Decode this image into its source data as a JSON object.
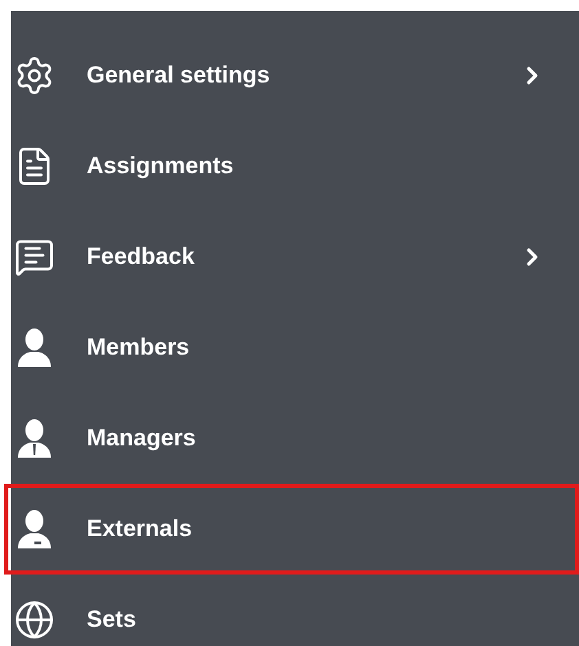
{
  "menu": {
    "items": [
      {
        "kind": "settings",
        "label": "General settings",
        "expandable": true,
        "selected": false
      },
      {
        "kind": "document",
        "label": "Assignments",
        "expandable": false,
        "selected": false
      },
      {
        "kind": "feedback",
        "label": "Feedback",
        "expandable": true,
        "selected": false
      },
      {
        "kind": "member",
        "label": "Members",
        "expandable": false,
        "selected": false
      },
      {
        "kind": "manager",
        "label": "Managers",
        "expandable": false,
        "selected": false
      },
      {
        "kind": "external",
        "label": "Externals",
        "expandable": false,
        "selected": true
      },
      {
        "kind": "globe",
        "label": "Sets",
        "expandable": false,
        "selected": false
      }
    ]
  }
}
